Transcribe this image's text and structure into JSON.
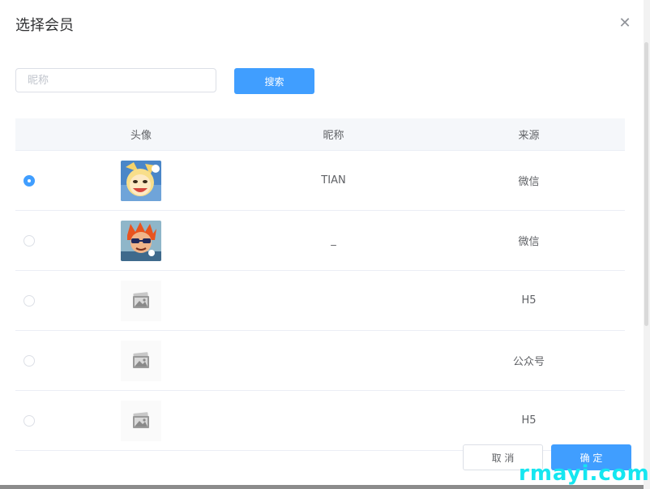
{
  "dialog": {
    "title": "选择会员",
    "close_icon": "close-icon"
  },
  "search": {
    "placeholder": "昵称",
    "value": "",
    "button_label": "搜索"
  },
  "table": {
    "columns": [
      "头像",
      "昵称",
      "来源"
    ],
    "rows": [
      {
        "selected": true,
        "avatar": "anime-avatar",
        "nickname": "TIAN",
        "source": "微信"
      },
      {
        "selected": false,
        "avatar": "cartoon-avatar",
        "nickname": "_",
        "source": "微信"
      },
      {
        "selected": false,
        "avatar": "image-placeholder-icon",
        "nickname": "",
        "source": "H5"
      },
      {
        "selected": false,
        "avatar": "image-placeholder-icon",
        "nickname": "",
        "source": "公众号"
      },
      {
        "selected": false,
        "avatar": "image-placeholder-icon",
        "nickname": "",
        "source": "H5"
      }
    ]
  },
  "footer": {
    "cancel_label": "取 消",
    "confirm_label": "确 定"
  },
  "watermark": "rmayi.com",
  "colors": {
    "primary": "#409eff",
    "header_bg": "#f5f7fa",
    "border": "#ebeef5",
    "watermark": "#15e6f0"
  }
}
